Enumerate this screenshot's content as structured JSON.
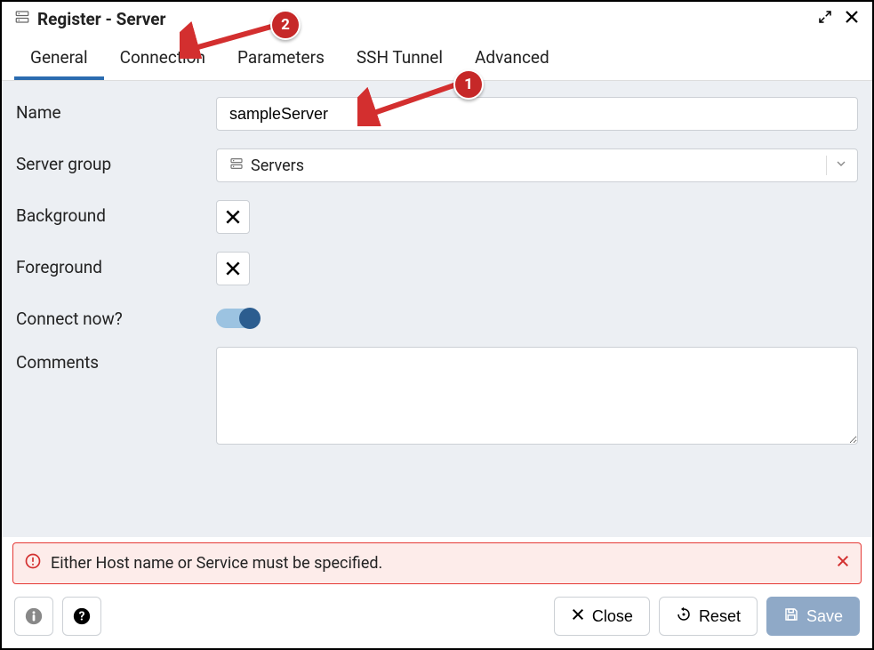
{
  "titlebar": {
    "title": "Register - Server"
  },
  "tabs": {
    "general": "General",
    "connection": "Connection",
    "parameters": "Parameters",
    "ssh_tunnel": "SSH Tunnel",
    "advanced": "Advanced"
  },
  "form": {
    "name_label": "Name",
    "name_value": "sampleServer",
    "server_group_label": "Server group",
    "server_group_value": "Servers",
    "background_label": "Background",
    "foreground_label": "Foreground",
    "connect_now_label": "Connect now?",
    "connect_now_value": true,
    "comments_label": "Comments",
    "comments_value": ""
  },
  "alert": {
    "message": "Either Host name or Service must be specified."
  },
  "footer": {
    "close_label": "Close",
    "reset_label": "Reset",
    "save_label": "Save"
  },
  "annotations": {
    "one": "1",
    "two": "2"
  }
}
